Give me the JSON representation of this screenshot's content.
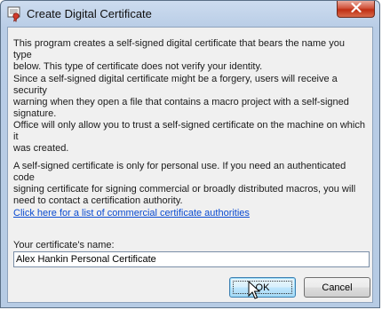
{
  "window": {
    "title": "Create Digital Certificate",
    "title_icon": "certificate-icon",
    "close_icon": "close-icon"
  },
  "body": {
    "paragraph1": "This program creates a self-signed digital certificate that bears the name you type\nbelow. This type of certificate does not verify your identity.",
    "paragraph2": "Since a self-signed digital certificate might be a forgery, users will receive a security\nwarning when they open a file that contains a macro project with a self-signed\nsignature.",
    "paragraph3": "Office will only allow you to trust a self-signed certificate on the machine on which it\nwas created.",
    "paragraph4": "A self-signed certificate is only for personal use. If you need an authenticated code\nsigning certificate for signing commercial or broadly distributed macros, you will\nneed to contact a certification authority.",
    "link_text": "Click here for a list of commercial certificate authorities"
  },
  "form": {
    "name_label": "Your certificate's name:",
    "name_value": "Alex Hankin Personal Certificate"
  },
  "buttons": {
    "ok_label": "OK",
    "cancel_label": "Cancel"
  },
  "colors": {
    "link": "#0a4bd1",
    "close_button": "#c02f14",
    "client_background": "#f0f0f0"
  }
}
